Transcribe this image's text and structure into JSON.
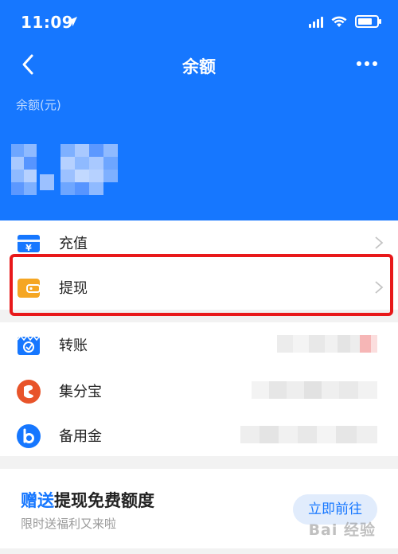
{
  "status_bar": {
    "time": "11:09"
  },
  "nav": {
    "title": "余额"
  },
  "balance": {
    "label": "余额(元)"
  },
  "rows": [
    {
      "label": "充值",
      "icon": "recharge-icon"
    },
    {
      "label": "提现",
      "icon": "wallet-icon"
    },
    {
      "label": "转账",
      "icon": "transfer-icon"
    },
    {
      "label": "集分宝",
      "icon": "points-icon"
    },
    {
      "label": "备用金",
      "icon": "reserve-fund-icon"
    }
  ],
  "promo": {
    "title_accent": "赠送",
    "title_rest": "提现免费额度",
    "subtitle": "限时送福利又来啦",
    "button": "立即前往"
  },
  "watermark": "Bai 经验",
  "colors": {
    "brand": "#1677ff",
    "highlight": "#e8181a",
    "wallet": "#f5a623",
    "points": "#e8542a"
  }
}
